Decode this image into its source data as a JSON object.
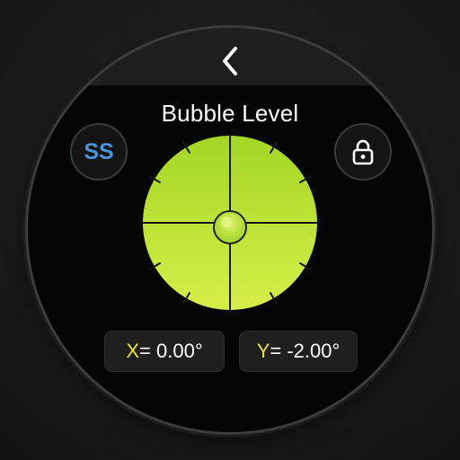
{
  "app": {
    "title": "Bubble Level"
  },
  "nav": {
    "back_icon": "chevron-left-icon"
  },
  "buttons": {
    "screenshot_label": "SS",
    "lock_icon": "lock-icon"
  },
  "level": {
    "x_axis_letter": "X",
    "x_value_text": "= 0.00°",
    "y_axis_letter": "Y",
    "y_value_text": "= -2.00°",
    "x_degrees": 0.0,
    "y_degrees": -2.0
  },
  "colors": {
    "level_light": "#c7ed3f",
    "level_dark": "#9acf22",
    "axis_letter": "#e6e23a",
    "ss_label": "#4a93d9"
  }
}
